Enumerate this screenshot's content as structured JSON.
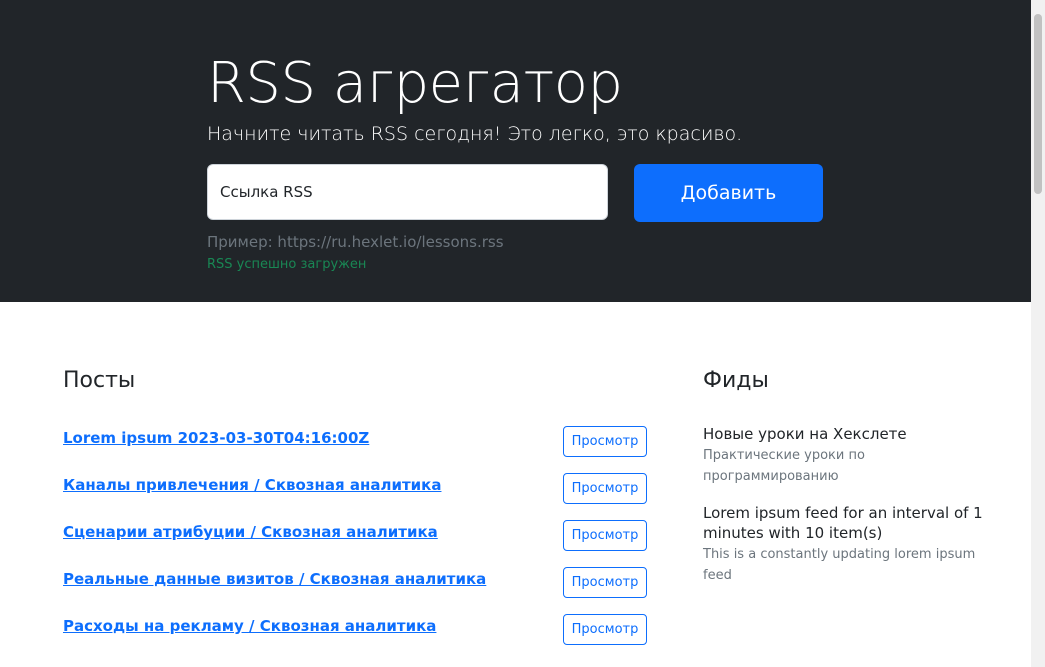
{
  "hero": {
    "title": "RSS агрегатор",
    "lead": "Начните читать RSS сегодня! Это легко, это красиво.",
    "input_placeholder": "Ссылка RSS",
    "add_button": "Добавить",
    "example": "Пример: https://ru.hexlet.io/lessons.rss",
    "feedback": "RSS успешно загружен"
  },
  "posts": {
    "title": "Посты",
    "view_label": "Просмотр",
    "items": [
      {
        "title": "Lorem ipsum 2023-03-30T04:16:00Z"
      },
      {
        "title": "Каналы привлечения / Сквозная аналитика"
      },
      {
        "title": "Сценарии атрибуции / Сквозная аналитика"
      },
      {
        "title": "Реальные данные визитов / Сквозная аналитика"
      },
      {
        "title": "Расходы на рекламу / Сквозная аналитика"
      }
    ]
  },
  "feeds": {
    "title": "Фиды",
    "items": [
      {
        "title": "Новые уроки на Хекслете",
        "description": "Практические уроки по программированию"
      },
      {
        "title": "Lorem ipsum feed for an interval of 1 minutes with 10 item(s)",
        "description": "This is a constantly updating lorem ipsum feed"
      }
    ]
  },
  "colors": {
    "hero_bg": "#212529",
    "primary": "#0d6efd",
    "success": "#198754",
    "muted": "#6c757d"
  }
}
